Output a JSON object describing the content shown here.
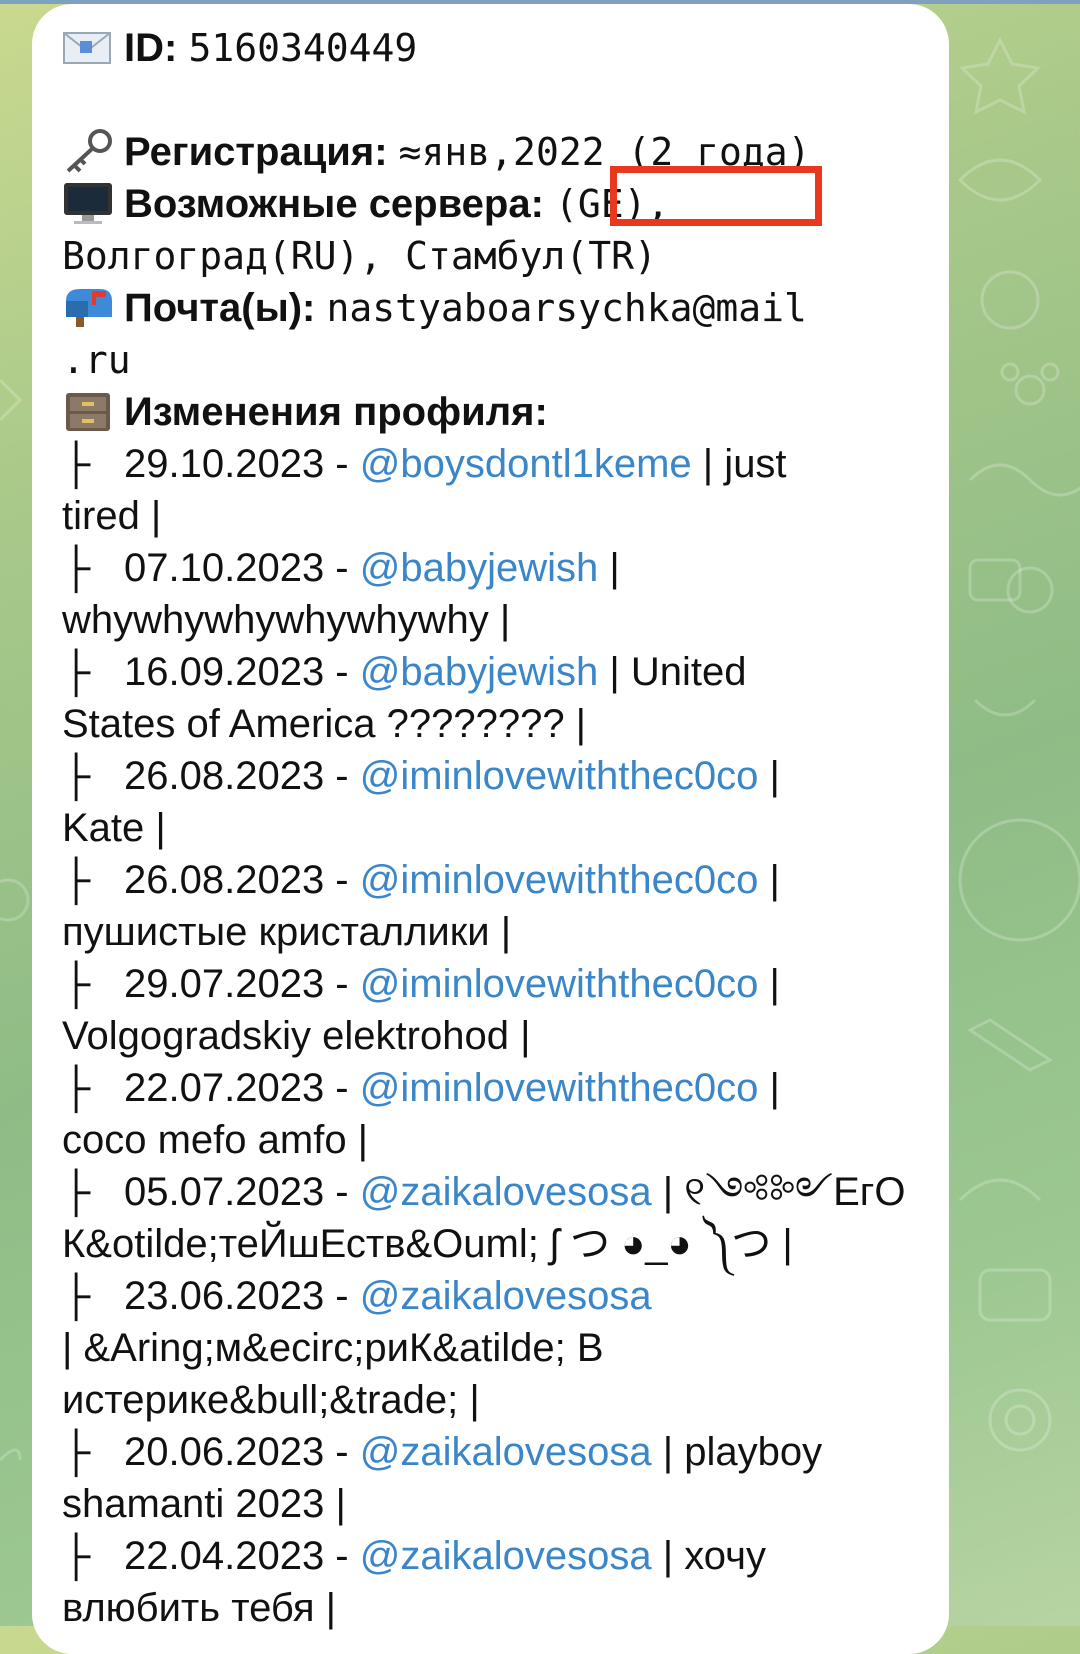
{
  "header": {
    "id_label": "ID:",
    "id_value": "5160340449"
  },
  "registration": {
    "label": "Регистрация:",
    "value": "≈янв,2022 (2 года)"
  },
  "servers": {
    "label": "Возможные сервера:",
    "value_line1": "(GE),",
    "value_line2": "Волгоград(RU), Стамбул(TR)"
  },
  "mail": {
    "label": "Почта(ы):",
    "value_line1": "nastyaboarsychka@mail",
    "value_line2": ".ru"
  },
  "changes": {
    "label": "Изменения профиля:",
    "tree_glyph": "├",
    "entries": [
      {
        "date": "29.10.2023 -",
        "username": "@boysdontl1keme",
        "after_head": "| just",
        "text": "tired |"
      },
      {
        "date": "07.10.2023 -",
        "username": "@babyjewish",
        "after_head": "|",
        "text": "whywhywhywhywhywhy |"
      },
      {
        "date": "16.09.2023 -",
        "username": "@babyjewish",
        "after_head": "| United",
        "text": "States of America ???????? |"
      },
      {
        "date": "26.08.2023 -",
        "username": "@iminlovewiththec0co",
        "after_head": "|",
        "text": "Kate |"
      },
      {
        "date": "26.08.2023 -",
        "username": "@iminlovewiththec0co",
        "after_head": "|",
        "text": "пушистые кристаллики |"
      },
      {
        "date": "29.07.2023 -",
        "username": "@iminlovewiththec0co",
        "after_head": "|",
        "text": "Volgogradskiy elektrohod |"
      },
      {
        "date": "22.07.2023 -",
        "username": "@iminlovewiththec0co",
        "after_head": "|",
        "text": "coco mefo amfo |"
      },
      {
        "date": "05.07.2023 -",
        "username": "@zaikalovesosa",
        "after_head": "| ୧༺༻ЕгО",
        "text": "К&otilde;теЙшЕств&Ouml; ʃ つ ◕_◕ ༽つ |"
      },
      {
        "date": "23.06.2023 -",
        "username": "@zaikalovesosa",
        "after_head": "",
        "text": "| &Aring;м&ecirc;риК&atilde; В",
        "text2": "истерике&bull;&trade; |"
      },
      {
        "date": "20.06.2023 -",
        "username": "@zaikalovesosa",
        "after_head": "| playboy",
        "text": "shamanti 2023 |"
      },
      {
        "date": "22.04.2023 -",
        "username": "@zaikalovesosa",
        "after_head": "| хочу",
        "text": "влюбить тебя |"
      }
    ]
  },
  "icons": {
    "envelope": "envelope-icon",
    "key": "key-icon",
    "computer": "desktop-computer-icon",
    "mailbox": "mailbox-icon",
    "cabinet": "file-cabinet-icon"
  },
  "colors": {
    "link": "#3a86c8",
    "highlight_box": "#e8391f",
    "background_start": "#c9d98f",
    "background_end": "#8fbc86"
  }
}
